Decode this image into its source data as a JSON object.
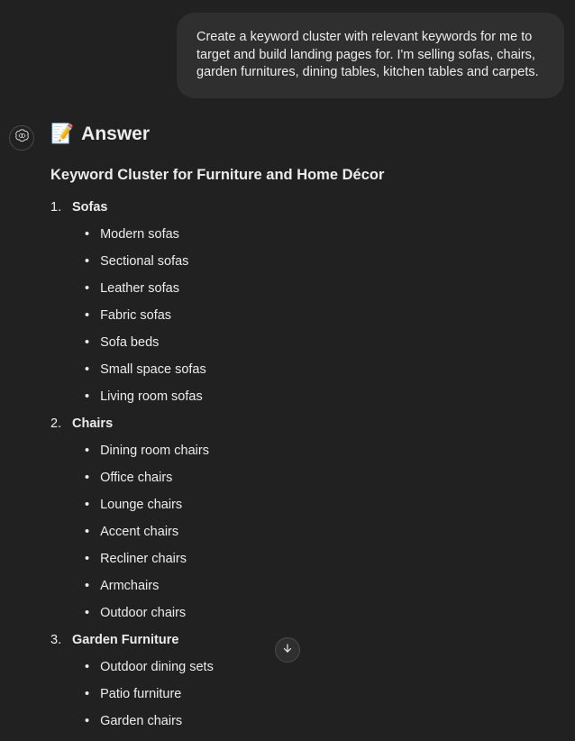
{
  "user_message": "Create a keyword cluster with relevant keywords for me to target and build landing pages for. I'm selling sofas, chairs, garden furnitures, dining tables, kitchen tables and carpets.",
  "answer": {
    "icon": "📝",
    "heading": "Answer",
    "subheading": "Keyword Cluster for Furniture and Home Décor",
    "categories": [
      {
        "number": "1.",
        "title": "Sofas",
        "items": [
          "Modern sofas",
          "Sectional sofas",
          "Leather sofas",
          "Fabric sofas",
          "Sofa beds",
          "Small space sofas",
          "Living room sofas"
        ]
      },
      {
        "number": "2.",
        "title": "Chairs",
        "items": [
          "Dining room chairs",
          "Office chairs",
          "Lounge chairs",
          "Accent chairs",
          "Recliner chairs",
          "Armchairs",
          "Outdoor chairs"
        ]
      },
      {
        "number": "3.",
        "title": "Garden Furniture",
        "items": [
          "Outdoor dining sets",
          "Patio furniture",
          "Garden chairs"
        ]
      }
    ]
  }
}
